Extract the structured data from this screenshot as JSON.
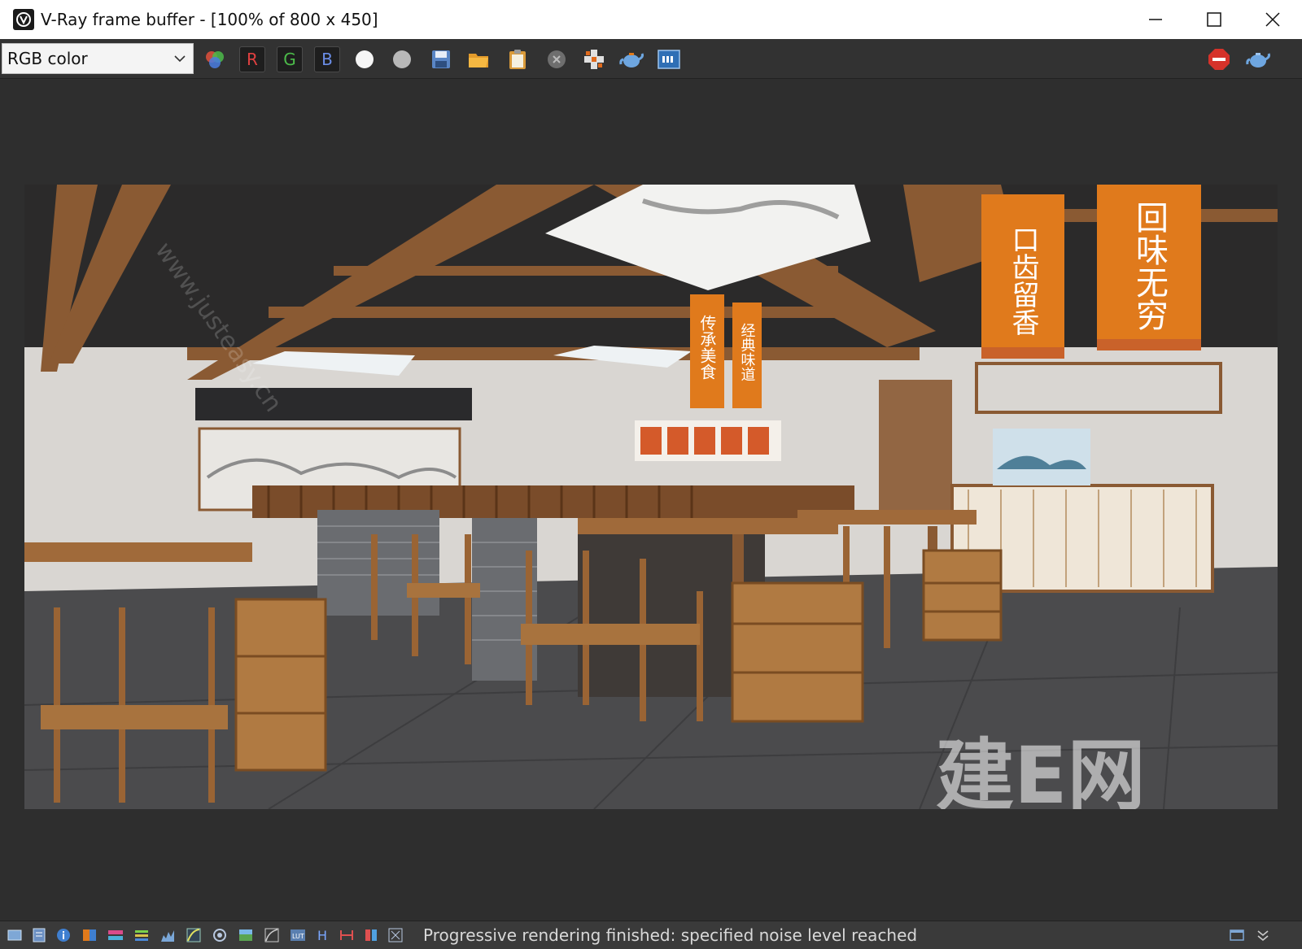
{
  "window": {
    "title": "V-Ray frame buffer - [100% of 800 x 450]",
    "controls": [
      "minimize",
      "maximize",
      "close"
    ]
  },
  "toolbar": {
    "channel_selected": "RGB color",
    "red_label": "R",
    "green_label": "G",
    "blue_label": "B",
    "icons": [
      "color-channels-icon",
      "white-circle-icon",
      "gray-circle-icon",
      "save-icon",
      "open-folder-icon",
      "clipboard-icon",
      "clear-icon",
      "crop-region-icon",
      "teapot-render-icon",
      "lens-effects-icon",
      "stop-icon",
      "teapot-icon"
    ]
  },
  "render": {
    "signs": {
      "sign_1": "口齿留香",
      "sign_2": "回味无穷",
      "banner_1": "传承美食",
      "banner_2": "经典味道"
    },
    "watermark": "建E网",
    "watermark_url": "www.justeasy.cn"
  },
  "status": {
    "text": "Progressive rendering finished: specified noise level reached"
  },
  "colors": {
    "sign_orange": "#e07a1c",
    "wood": "#8a5a33",
    "toolbar_bg": "#323232",
    "viewport_bg": "#2e2e2e"
  }
}
